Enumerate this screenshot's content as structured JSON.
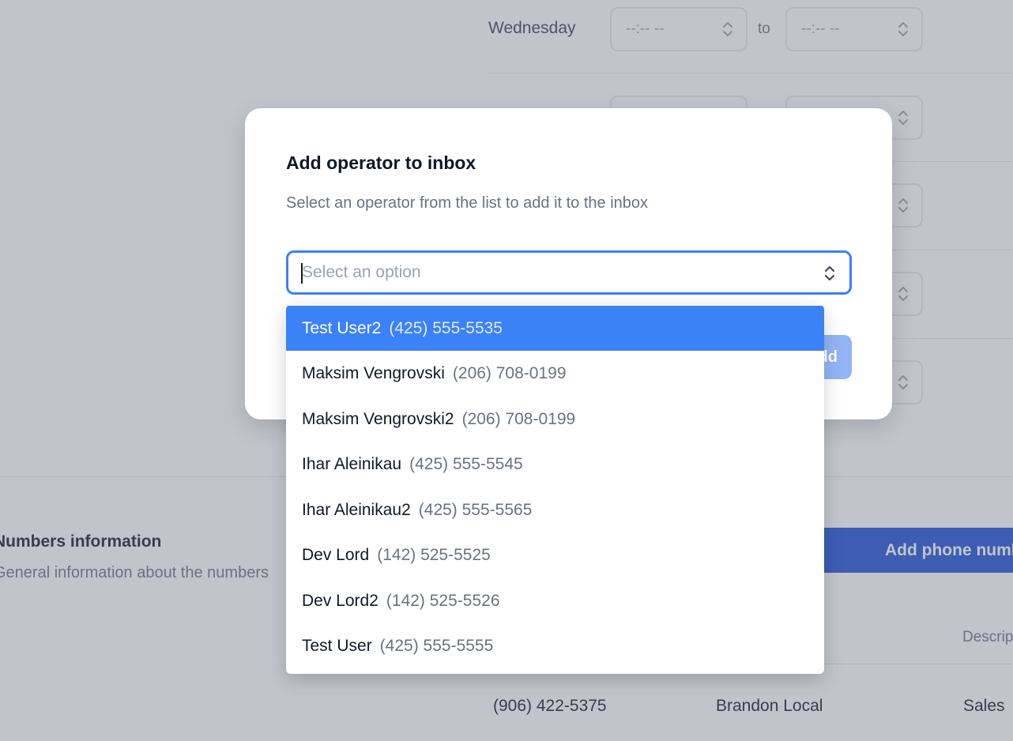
{
  "background": {
    "schedule": {
      "day_label": "Wednesday",
      "start_placeholder": "--:-- --",
      "to_label": "to",
      "end_placeholder": "--:-- --"
    },
    "numbers_section": {
      "title": "Numbers information",
      "subtitle": "General information about the numbers",
      "add_button_label": "Add phone numbers",
      "description_header": "Description"
    },
    "table_row": {
      "number": "(906) 422-5375",
      "name": "Brandon Local",
      "description": "Sales"
    }
  },
  "modal": {
    "title": "Add operator to inbox",
    "description": "Select an operator from the list to add it to the inbox",
    "select": {
      "placeholder": "Select an option",
      "value": ""
    },
    "add_button_label": "Add"
  },
  "dropdown": {
    "options": [
      {
        "name": "Test User2",
        "phone": "(425) 555-5535",
        "active": true
      },
      {
        "name": "Maksim Vengrovski",
        "phone": "(206) 708-0199",
        "active": false
      },
      {
        "name": "Maksim Vengrovski2",
        "phone": "(206) 708-0199",
        "active": false
      },
      {
        "name": "Ihar Aleinikau",
        "phone": "(425) 555-5545",
        "active": false
      },
      {
        "name": "Ihar Aleinikau2",
        "phone": "(425) 555-5565",
        "active": false
      },
      {
        "name": "Dev Lord",
        "phone": "(142) 525-5525",
        "active": false
      },
      {
        "name": "Dev Lord2",
        "phone": "(142) 525-5526",
        "active": false
      },
      {
        "name": "Test User",
        "phone": "(425) 555-5555",
        "active": false
      }
    ]
  },
  "colors": {
    "accent": "#3b82f6",
    "primary_button": "#1d4ed8",
    "overlay": "#6b7280"
  }
}
